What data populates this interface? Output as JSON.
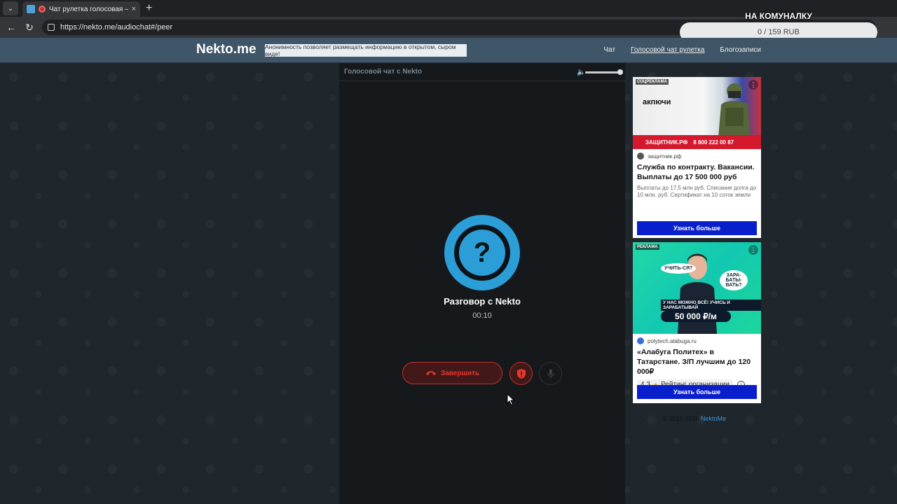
{
  "browser": {
    "tab_title": "Чат рулетка голосовая — N",
    "tab_close": "×",
    "new_tab": "+",
    "url": "https://nekto.me/audiochat#/peer"
  },
  "donation": {
    "title": "НА КОМУНАЛКУ",
    "progress_text": "0 / 159 RUB",
    "progress_fraction": 0
  },
  "site": {
    "logo": "Nekto.me",
    "notice": "Анонимность позволяет размещать информацию в открытом, сыром виде!",
    "nav": [
      {
        "label": "Чат"
      },
      {
        "label": "Голосовой чат рулетка",
        "active": true
      },
      {
        "label": "Блогозаписи"
      }
    ]
  },
  "call": {
    "header_title": "Голосовой чат с Nekto",
    "volume_fraction": 1.0,
    "avatar_symbol": "?",
    "peer_name": "Разговор с Nekto",
    "timer": "00:10",
    "end_button": "Завершить",
    "accent": "#2b9ed8",
    "danger": "#e2392f"
  },
  "ads": [
    {
      "label": "СОЦРЕКЛАМА",
      "banner_text": "акпючи",
      "strip_brand": "ЗАЩИТНИК.РФ",
      "strip_phone": "8 800 222 00 87",
      "domain": "защитник.рф",
      "headline": "Служба по контракту. Вакансии. Выплаты до 17 500 000 руб",
      "description": "Выплаты до 17,5 млн руб. Списание долга до 10 млн. руб. Сертификат на 10 соток земли",
      "cta": "Узнать больше"
    },
    {
      "label": "РЕКЛАМА",
      "bubble_1": "УЧИТЬ-СЯ?",
      "bubble_2": "ЗАРА-БАТЫ-ВАТЬ?",
      "slogan": "У НАС МОЖНО ВСЁ! УЧИСЬ И ЗАРАБАТЫВАЙ",
      "money": "50 000 ₽/м",
      "domain": "polytech.alabuga.ru",
      "headline": "«Алабуга Политех» в Татарстане. З/П лучшим до 120 000₽",
      "rating": "4,3",
      "rating_label": "Рейтинг организации",
      "cta": "Узнать больше"
    }
  ],
  "footer": {
    "copyright": "© 2011-2026",
    "link": "NektoMe"
  }
}
